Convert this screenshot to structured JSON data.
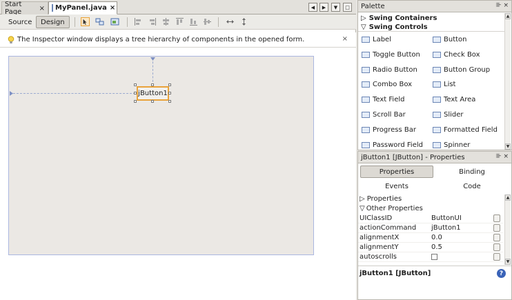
{
  "editor": {
    "tabs": [
      {
        "label": "Start Page",
        "close": "×"
      },
      {
        "label": "MyPanel.java",
        "close": "×"
      }
    ],
    "nav": {
      "left": "◀",
      "right": "▶",
      "down": "▼",
      "restore": "□"
    },
    "toolbar": {
      "source": "Source",
      "design": "Design"
    },
    "info": {
      "text": "The Inspector window displays a tree hierarchy of components in the opened form.",
      "close": "×"
    },
    "component": {
      "label": "jButton1"
    }
  },
  "palette": {
    "title": "Palette",
    "controls": "⊪ ×",
    "categories": [
      {
        "arrow": "▷",
        "label": "Swing Containers"
      },
      {
        "arrow": "▽",
        "label": "Swing Controls"
      }
    ],
    "items": [
      {
        "label": "Label",
        "icon": "label-icon"
      },
      {
        "label": "Button",
        "icon": "button-icon"
      },
      {
        "label": "Toggle Button",
        "icon": "toggle-button-icon"
      },
      {
        "label": "Check Box",
        "icon": "check-box-icon"
      },
      {
        "label": "Radio Button",
        "icon": "radio-button-icon"
      },
      {
        "label": "Button Group",
        "icon": "button-group-icon"
      },
      {
        "label": "Combo Box",
        "icon": "combo-box-icon"
      },
      {
        "label": "List",
        "icon": "list-icon"
      },
      {
        "label": "Text Field",
        "icon": "text-field-icon"
      },
      {
        "label": "Text Area",
        "icon": "text-area-icon"
      },
      {
        "label": "Scroll Bar",
        "icon": "scroll-bar-icon"
      },
      {
        "label": "Slider",
        "icon": "slider-icon"
      },
      {
        "label": "Progress Bar",
        "icon": "progress-bar-icon"
      },
      {
        "label": "Formatted Field",
        "icon": "formatted-field-icon"
      },
      {
        "label": "Password Field",
        "icon": "password-field-icon"
      },
      {
        "label": "Spinner",
        "icon": "spinner-icon"
      }
    ]
  },
  "properties": {
    "title": "jButton1 [JButton] - Properties",
    "controls": "⊪ ×",
    "tabs": {
      "properties": "Properties",
      "binding": "Binding",
      "events": "Events",
      "code": "Code"
    },
    "sections": [
      {
        "arrow": "▷",
        "label": "Properties"
      },
      {
        "arrow": "▽",
        "label": "Other Properties"
      }
    ],
    "rows": [
      {
        "name": "UIClassID",
        "value": "ButtonUI"
      },
      {
        "name": "actionCommand",
        "value": "jButton1"
      },
      {
        "name": "alignmentX",
        "value": "0.0"
      },
      {
        "name": "alignmentY",
        "value": "0.5"
      },
      {
        "name": "autoscrolls",
        "value": ""
      }
    ],
    "footer": {
      "title": "jButton1 [JButton]",
      "help": "?"
    }
  }
}
